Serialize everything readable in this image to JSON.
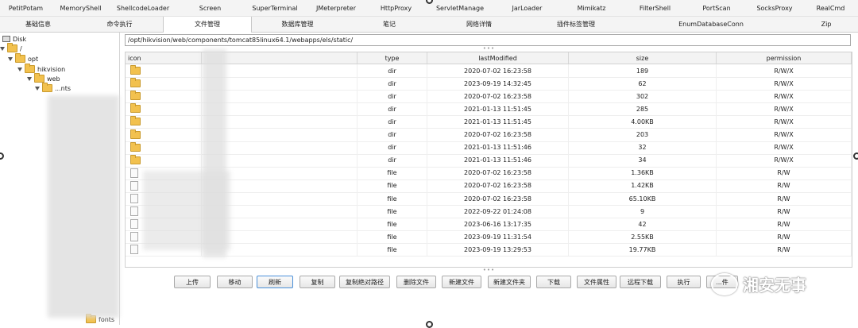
{
  "toolbar_row1": [
    "PetitPotam",
    "MemoryShell",
    "ShellcodeLoader",
    "Screen",
    "SuperTerminal",
    "JMeterpreter",
    "HttpProxy",
    "ServletManage",
    "JarLoader",
    "Mimikatz",
    "FilterShell",
    "PortScan",
    "SocksProxy",
    "RealCmd"
  ],
  "toolbar_row2": [
    "基础信息",
    "命令执行",
    "文件管理",
    "数据库管理",
    "笔记",
    "网络详情",
    "插件标签管理",
    "EnumDatabaseConn",
    "Zip"
  ],
  "active_tab": "文件管理",
  "tree": [
    {
      "label": "Disk",
      "icon": "disk-icon",
      "expanded": true
    },
    {
      "label": "/",
      "icon": "folder-icon",
      "expanded": true
    },
    {
      "label": "opt",
      "icon": "folder-icon",
      "expanded": true
    },
    {
      "label": "hikvision",
      "icon": "folder-icon",
      "expanded": true
    },
    {
      "label": "web",
      "icon": "folder-icon",
      "expanded": true
    },
    {
      "label": "...nts",
      "icon": "folder-icon",
      "expanded": true
    },
    {
      "label": "fonts",
      "icon": "folder-icon",
      "expanded": false
    }
  ],
  "path_value": "/opt/hikvision/web/components/tomcat85linux64.1/webapps/els/static/",
  "table": {
    "headers": {
      "icon": "icon",
      "name": "",
      "type": "type",
      "lastModified": "lastModified",
      "size": "size",
      "permission": "permission"
    },
    "rows": [
      {
        "type": "dir",
        "lastModified": "2020-07-02 16:23:58",
        "size": "189",
        "permission": "R/W/X"
      },
      {
        "type": "dir",
        "lastModified": "2023-09-19 14:32:45",
        "size": "62",
        "permission": "R/W/X"
      },
      {
        "type": "dir",
        "lastModified": "2020-07-02 16:23:58",
        "size": "302",
        "permission": "R/W/X"
      },
      {
        "type": "dir",
        "lastModified": "2021-01-13 11:51:45",
        "size": "285",
        "permission": "R/W/X"
      },
      {
        "type": "dir",
        "lastModified": "2021-01-13 11:51:45",
        "size": "4.00KB",
        "permission": "R/W/X"
      },
      {
        "type": "dir",
        "lastModified": "2020-07-02 16:23:58",
        "size": "203",
        "permission": "R/W/X"
      },
      {
        "type": "dir",
        "lastModified": "2021-01-13 11:51:46",
        "size": "32",
        "permission": "R/W/X"
      },
      {
        "type": "dir",
        "lastModified": "2021-01-13 11:51:46",
        "size": "34",
        "permission": "R/W/X"
      },
      {
        "type": "file",
        "lastModified": "2020-07-02 16:23:58",
        "size": "1.36KB",
        "permission": "R/W"
      },
      {
        "type": "file",
        "lastModified": "2020-07-02 16:23:58",
        "size": "1.42KB",
        "permission": "R/W"
      },
      {
        "type": "file",
        "lastModified": "2020-07-02 16:23:58",
        "size": "65.10KB",
        "permission": "R/W"
      },
      {
        "type": "file",
        "lastModified": "2022-09-22 01:24:08",
        "size": "9",
        "permission": "R/W"
      },
      {
        "type": "file",
        "lastModified": "2023-06-16 13:17:35",
        "size": "42",
        "permission": "R/W"
      },
      {
        "type": "file",
        "lastModified": "2023-09-19 11:31:54",
        "size": "2.55KB",
        "permission": "R/W"
      },
      {
        "type": "file",
        "lastModified": "2023-09-19 13:29:53",
        "size": "19.77KB",
        "permission": "R/W"
      }
    ]
  },
  "buttons": [
    "上传",
    "移动",
    "刷新",
    "复制",
    "复制绝对路径",
    "删除文件",
    "新建文件",
    "新建文件夹",
    "下载",
    "文件属性",
    "远程下载",
    "执行",
    "...件"
  ],
  "focused_button": "刷新",
  "watermark": "湘安无事",
  "colors": {
    "folder": "#f2c14e",
    "focus": "#4a90d9",
    "toolbar_bg": "#f4f4f4"
  }
}
